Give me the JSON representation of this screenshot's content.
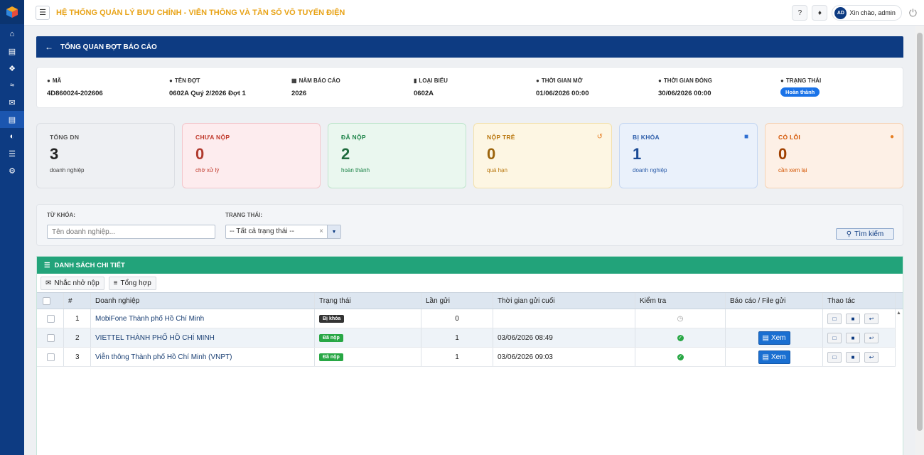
{
  "app": {
    "title": "HỆ THỐNG QUẢN LÝ BƯU CHÍNH - VIỄN THÔNG VÀ TẦN SỐ VÔ TUYẾN ĐIỆN"
  },
  "user": {
    "initials": "AD",
    "greeting": "Xin chào, admin"
  },
  "page": {
    "title": "TỔNG QUAN ĐỢT BÁO CÁO"
  },
  "info": [
    {
      "label": "MÃ",
      "value": "4D860024-202606",
      "icon": "tag-icon"
    },
    {
      "label": "TÊN ĐỢT",
      "value": "0602A Quý 2/2026 Đợt 1",
      "icon": "tag-icon"
    },
    {
      "label": "NĂM BÁO CÁO",
      "value": "2026",
      "icon": "calendar-icon"
    },
    {
      "label": "LOẠI BIỂU",
      "value": "0602A",
      "icon": "file-icon"
    },
    {
      "label": "THỜI GIAN MỞ",
      "value": "01/06/2026 00:00",
      "icon": "clock-icon"
    },
    {
      "label": "THỜI GIAN ĐÓNG",
      "value": "30/06/2026 00:00",
      "icon": "clock-icon"
    },
    {
      "label": "TRẠNG THÁI",
      "value": "Hoàn thành",
      "icon": "info-icon"
    }
  ],
  "stats": [
    {
      "title": "TỔNG DN",
      "number": "3",
      "sub": "doanh nghiệp"
    },
    {
      "title": "CHƯA NỘP",
      "number": "0",
      "sub": "chờ xử lý"
    },
    {
      "title": "ĐÃ NỘP",
      "number": "2",
      "sub": "hoàn thành"
    },
    {
      "title": "NỘP TRỄ",
      "number": "0",
      "sub": "quá hạn"
    },
    {
      "title": "BỊ KHÓA",
      "number": "1",
      "sub": "doanh nghiệp"
    },
    {
      "title": "CÓ LỖI",
      "number": "0",
      "sub": "cần xem lại"
    }
  ],
  "filter": {
    "keyword_label": "TỪ KHÓA:",
    "keyword_placeholder": "Tên doanh nghiệp...",
    "status_label": "TRẠNG THÁI:",
    "status_value": "-- Tất cả trạng thái --",
    "search_label": "Tìm kiếm"
  },
  "list": {
    "title": "DANH SÁCH CHI TIẾT",
    "remind_label": "Nhắc nhở nộp",
    "summary_label": "Tổng hợp",
    "columns": [
      "#",
      "Doanh nghiệp",
      "Trạng thái",
      "Lần gửi",
      "Thời gian gửi cuối",
      "Kiểm tra",
      "Báo cáo / File gửi",
      "Thao tác"
    ],
    "rows": [
      {
        "no": "1",
        "company": "MobiFone Thành phố Hồ Chí Minh",
        "status": "Bị khóa",
        "sends": "0",
        "last": "",
        "check": "pending",
        "view": ""
      },
      {
        "no": "2",
        "company": "VIETTEL THÀNH PHỐ HỒ CHÍ MINH",
        "status": "Đã nộp",
        "sends": "1",
        "last": "03/06/2026 08:49",
        "check": "ok",
        "view": "Xem"
      },
      {
        "no": "3",
        "company": "Viễn thông Thành phố Hồ Chí Minh (VNPT)",
        "status": "Đã nộp",
        "sends": "1",
        "last": "03/06/2026 09:03",
        "check": "ok",
        "view": "Xem"
      }
    ]
  }
}
